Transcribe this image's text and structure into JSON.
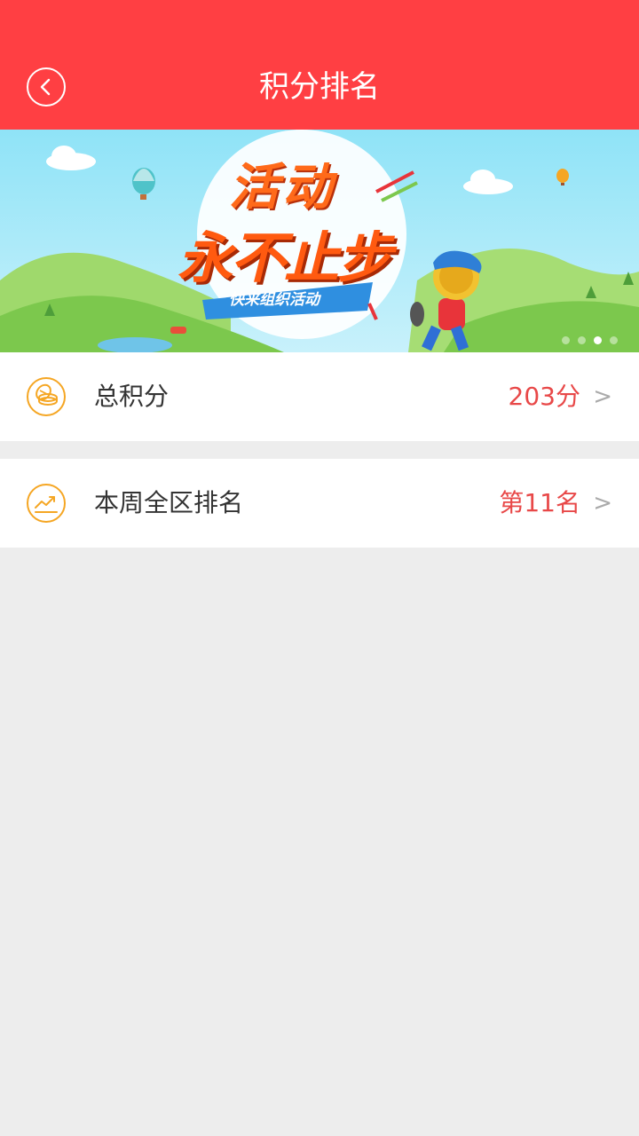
{
  "header": {
    "title": "积分排名",
    "back_icon": "chevron-left-icon",
    "background": "#ff3f43"
  },
  "banner": {
    "headline_line1": "活动",
    "headline_line2": "永不止步",
    "tagline": "快来组织活动",
    "dots": 4,
    "active_dot": 3
  },
  "rows": [
    {
      "label": "总积分",
      "value": "203分",
      "arrow": ">",
      "icon": "coins-icon"
    },
    {
      "label": "本周全区排名",
      "value": "第11名",
      "arrow": ">",
      "icon": "trend-chart-icon"
    }
  ],
  "colors": {
    "accent": "#ff3f43",
    "value_red": "#e84848",
    "icon_orange": "#f5a623",
    "page_bg": "#ededed"
  }
}
